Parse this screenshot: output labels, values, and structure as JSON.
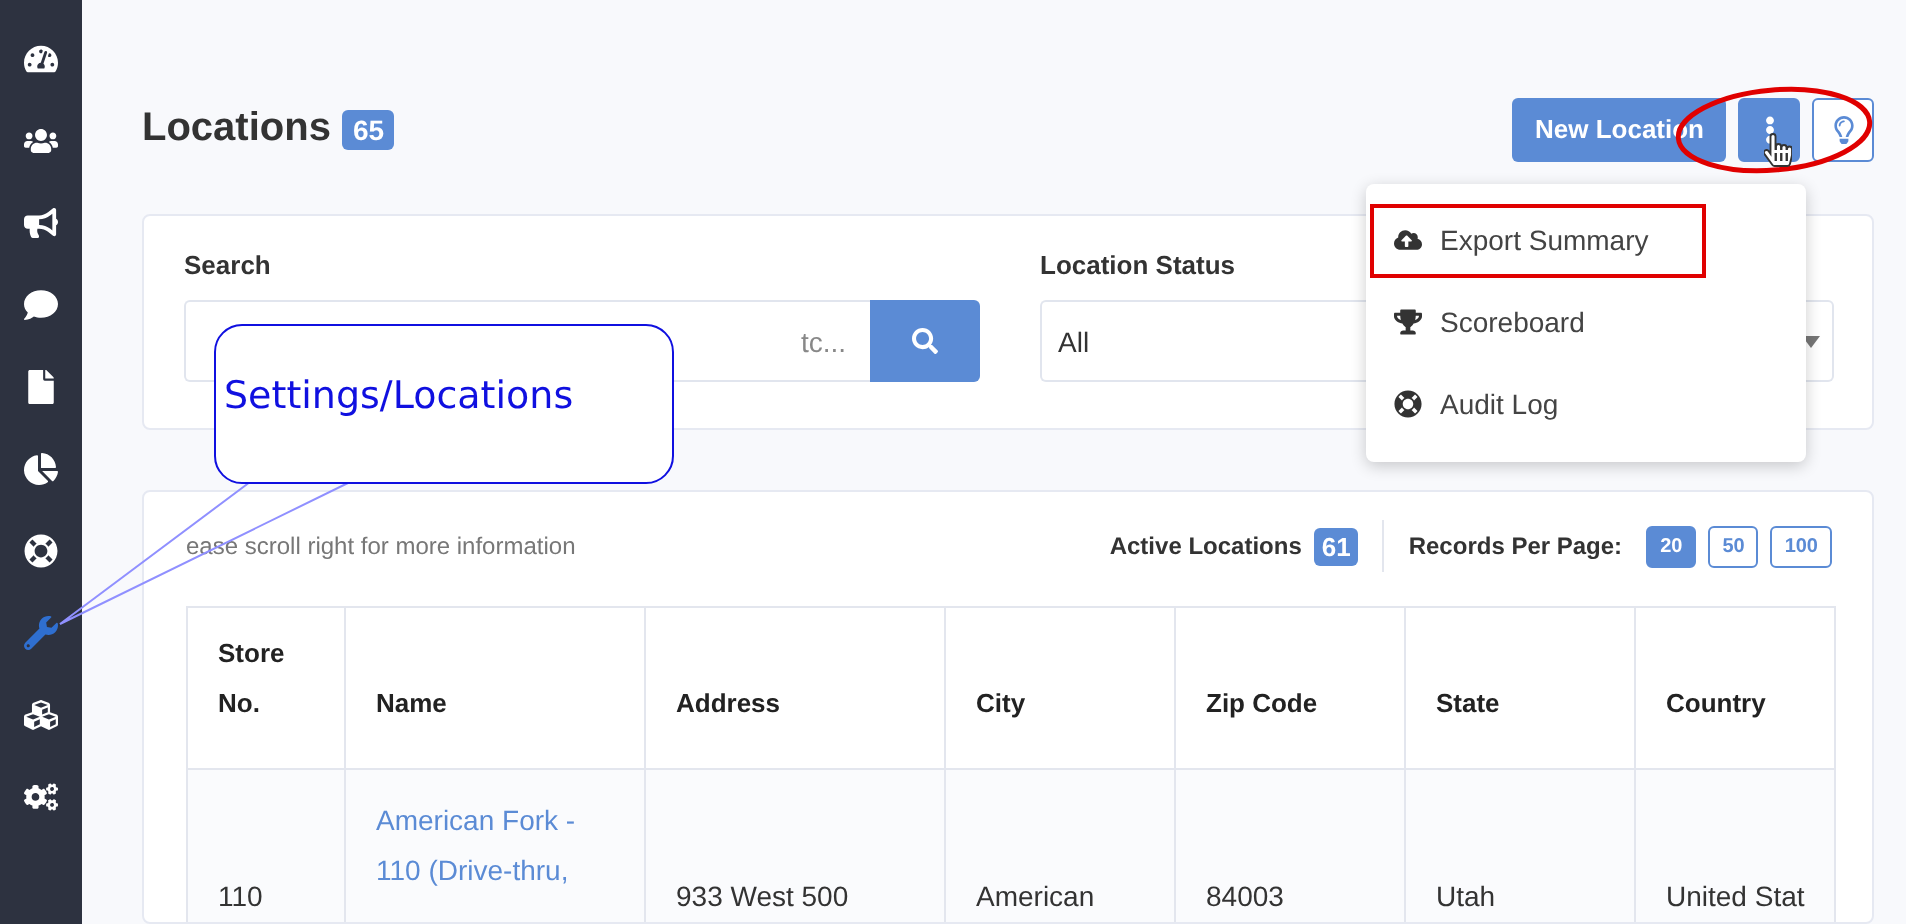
{
  "sidebar": {
    "items": [
      {
        "kind": "gauge",
        "selected": false
      },
      {
        "kind": "users",
        "selected": false
      },
      {
        "kind": "bullhorn",
        "selected": false
      },
      {
        "kind": "comment",
        "selected": false
      },
      {
        "kind": "file",
        "selected": false
      },
      {
        "kind": "pie",
        "selected": false
      },
      {
        "kind": "lifering",
        "selected": false
      },
      {
        "kind": "wrench",
        "selected": true
      },
      {
        "kind": "cubes",
        "selected": false
      },
      {
        "kind": "cogs",
        "selected": false
      }
    ]
  },
  "header": {
    "title": "Locations",
    "count": "65",
    "new_button": "New Location"
  },
  "menu": {
    "items": [
      {
        "kind": "export",
        "label": "Export Summary",
        "marked": true
      },
      {
        "kind": "trophy",
        "label": "Scoreboard",
        "marked": false
      },
      {
        "kind": "lifering",
        "label": "Audit Log",
        "marked": false
      }
    ]
  },
  "filters": {
    "search_label": "Search",
    "search_placeholder": "tc...",
    "status_label": "Location Status",
    "status_value": "All"
  },
  "table_card": {
    "hint": "ease scroll right for more information",
    "active_label": "Active Locations",
    "active_count": "61",
    "per_page_label": "Records Per Page:",
    "per_page": [
      {
        "label": "20",
        "selected": true
      },
      {
        "label": "50",
        "selected": false
      },
      {
        "label": "100",
        "selected": false
      }
    ]
  },
  "table": {
    "columns": [
      "Store\nNo.",
      "Name",
      "Address",
      "City",
      "Zip Code",
      "State",
      "Country"
    ],
    "rows": [
      {
        "store": "110",
        "name": "American Fork - 110 (Drive-thru,",
        "address": "933 West 500",
        "city": "American",
        "zip": "84003",
        "state": "Utah",
        "country": "United Stat"
      }
    ]
  },
  "annotation": {
    "callout": "Settings/Locations"
  }
}
